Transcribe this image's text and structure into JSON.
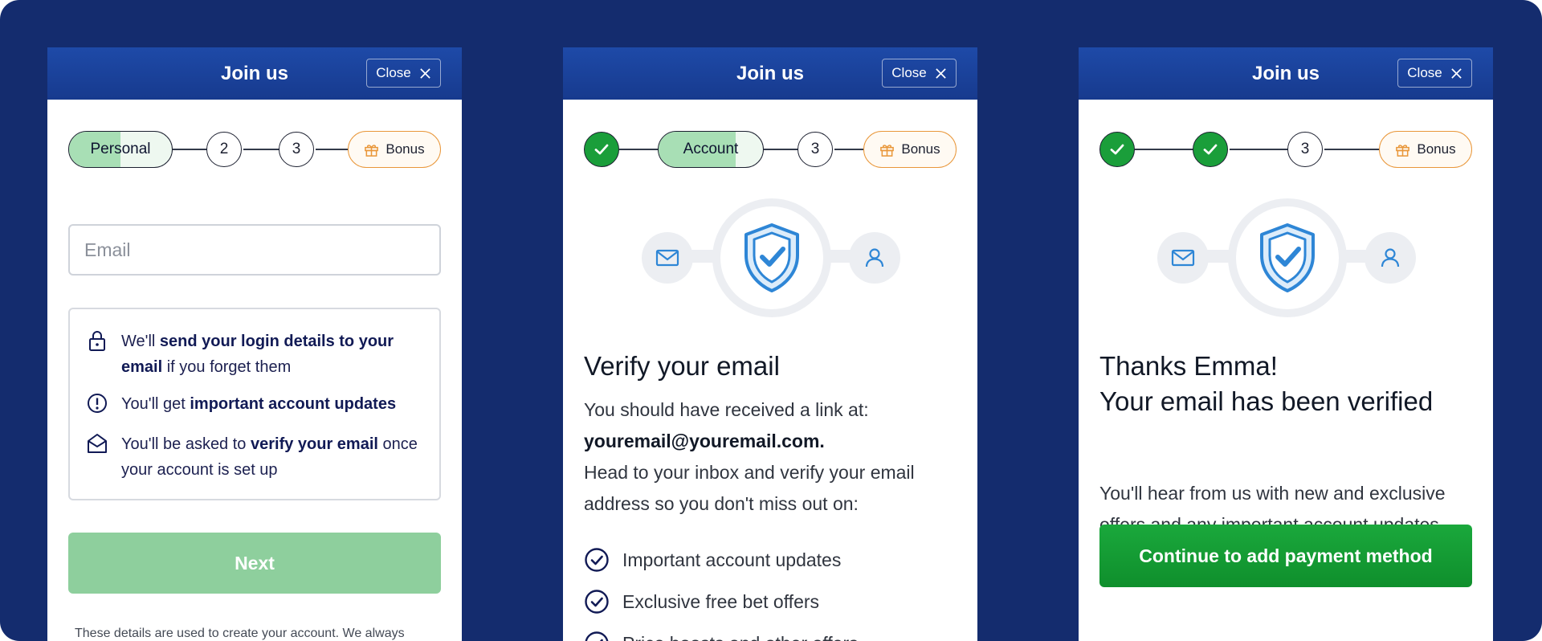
{
  "colors": {
    "background": "#142c6e",
    "header": "#1e4aa8",
    "success": "#1a9e3a",
    "disabled_button": "#8ecf9d",
    "bonus_border": "#e9973a",
    "icon_blue": "#2e86d6"
  },
  "panels": [
    {
      "title": "Join us",
      "close_label": "Close",
      "stepper": {
        "active_label": "Personal",
        "step2": "2",
        "step3": "3",
        "bonus": "Bonus"
      },
      "email_placeholder": "Email",
      "info": [
        {
          "icon": "lock-icon",
          "pre": "We'll ",
          "bold": "send your login details to your email",
          "post": " if you forget them"
        },
        {
          "icon": "alert-circle-icon",
          "pre": "You'll get ",
          "bold": "important account updates",
          "post": ""
        },
        {
          "icon": "envelope-open-icon",
          "pre": "You'll be asked to ",
          "bold": "verify your email",
          "post": " once your account is set up"
        }
      ],
      "next_label": "Next",
      "footnote": "These details are used to create your account. We always"
    },
    {
      "title": "Join us",
      "close_label": "Close",
      "stepper": {
        "active_label": "Account",
        "step3": "3",
        "bonus": "Bonus"
      },
      "heading": "Verify your email",
      "line1": "You should have received a link at:",
      "email": "youremail@youremail.com.",
      "line2": "Head to your inbox and verify your email address so you don't miss out on:",
      "checks": [
        "Important account updates",
        "Exclusive free bet offers",
        "Price boosts and other offers"
      ]
    },
    {
      "title": "Join us",
      "close_label": "Close",
      "stepper": {
        "step3": "3",
        "bonus": "Bonus"
      },
      "heading_line1": "Thanks Emma!",
      "heading_line2": "Your email has been verified",
      "body": "You'll hear from us with new and exclusive offers and any important account updates.",
      "continue_label": "Continue to add payment method"
    }
  ]
}
